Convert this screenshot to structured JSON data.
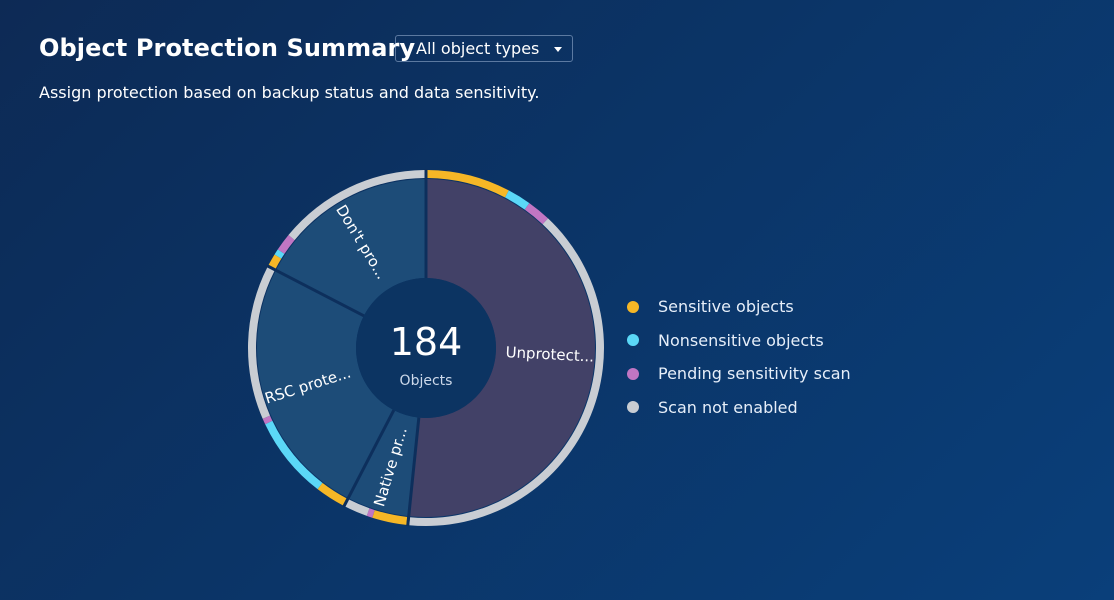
{
  "header": {
    "title": "Object Protection Summary",
    "subtitle": "Assign protection based on backup status and data sensitivity.",
    "filter": {
      "selected": "All object types"
    }
  },
  "colors": {
    "sensitive": "#f6b726",
    "nonsensitive": "#5bd8f7",
    "pending": "#c076c3",
    "not_enabled": "#c9cdd3",
    "unprotected_fill": "#424167",
    "protected_fill": "#1d4c78",
    "center_fill": "#0c3462"
  },
  "chart_data": {
    "type": "pie",
    "center": {
      "value": "184",
      "label": "Objects"
    },
    "total": 184,
    "legend_position": "right",
    "legend": [
      {
        "key": "sensitive",
        "label": "Sensitive objects",
        "color": "#f6b726"
      },
      {
        "key": "nonsensitive",
        "label": "Nonsensitive objects",
        "color": "#5bd8f7"
      },
      {
        "key": "pending",
        "label": "Pending sensitivity scan",
        "color": "#c076c3"
      },
      {
        "key": "not_enabled",
        "label": "Scan not enabled",
        "color": "#c9cdd3"
      }
    ],
    "slices": [
      {
        "label": "Unprotect...",
        "value": 95,
        "fill": "unprotected",
        "breakdown": {
          "sensitive": 14,
          "nonsensitive": 4,
          "pending": 4,
          "not_enabled": 73
        }
      },
      {
        "label": "Native pr...",
        "value": 11,
        "fill": "protected",
        "breakdown": {
          "sensitive": 6,
          "nonsensitive": 0,
          "pending": 1,
          "not_enabled": 4
        }
      },
      {
        "label": "RSC prote...",
        "value": 46,
        "fill": "protected",
        "breakdown": {
          "sensitive": 5,
          "nonsensitive": 14,
          "pending": 1,
          "not_enabled": 26
        }
      },
      {
        "label": "Don't pro...",
        "value": 32,
        "fill": "protected",
        "breakdown": {
          "sensitive": 2,
          "nonsensitive": 1,
          "pending": 3,
          "not_enabled": 26
        }
      }
    ]
  }
}
